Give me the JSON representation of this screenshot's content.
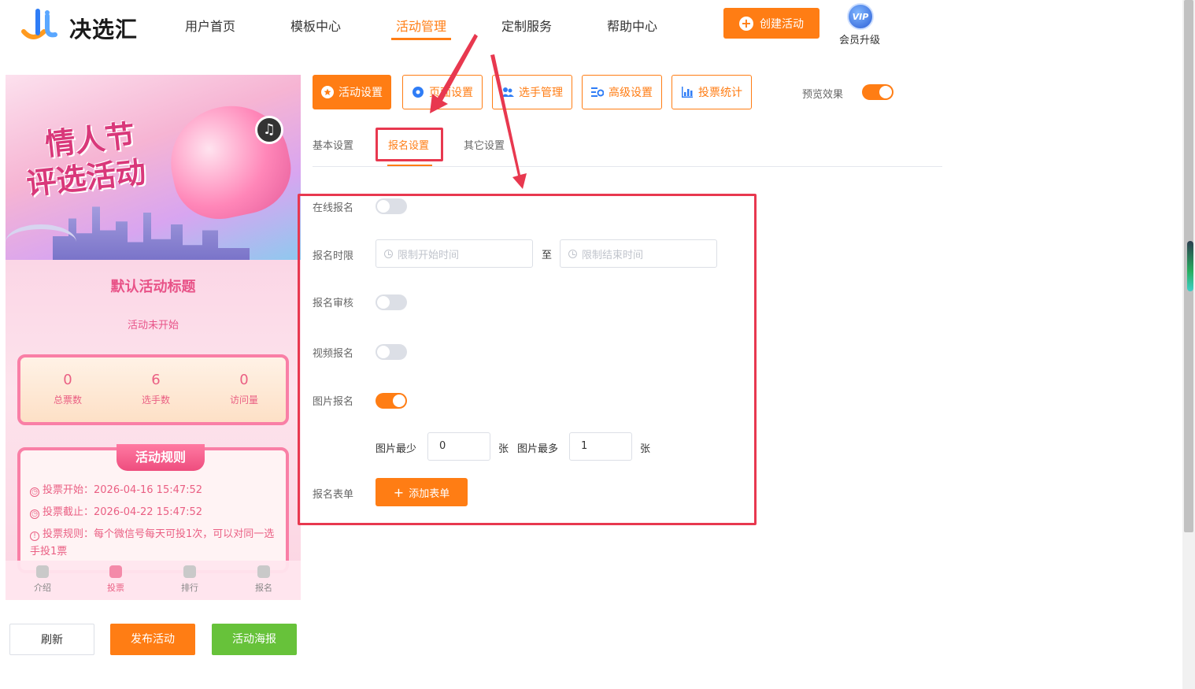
{
  "header": {
    "logo_text": "决选汇",
    "nav": [
      "用户首页",
      "模板中心",
      "活动管理",
      "定制服务",
      "帮助中心"
    ],
    "active_nav": "活动管理",
    "create_button": "创建活动",
    "vip_badge": "VIP",
    "vip_label": "会员升级"
  },
  "preview": {
    "banner_line1": "情人节",
    "banner_line2": "评选活动",
    "activity_title": "默认活动标题",
    "activity_status": "活动未开始",
    "stats": [
      {
        "value": "0",
        "label": "总票数"
      },
      {
        "value": "6",
        "label": "选手数"
      },
      {
        "value": "0",
        "label": "访问量"
      }
    ],
    "rules_title": "活动规则",
    "rules": [
      "投票开始：2026-04-16 15:47:52",
      "投票截止：2026-04-22 15:47:52",
      "投票规则：每个微信号每天可投1次，可以对同一选手投1票"
    ],
    "tabbar": [
      "介绍",
      "投票",
      "排行",
      "报名"
    ],
    "active_tab": "投票"
  },
  "actions": {
    "refresh": "刷新",
    "publish": "发布活动",
    "poster": "活动海报"
  },
  "toolbar": {
    "buttons": [
      "活动设置",
      "页面设置",
      "选手管理",
      "高级设置",
      "投票统计"
    ],
    "active": "活动设置",
    "preview_label": "预览效果",
    "preview_on": true
  },
  "subtabs": {
    "items": [
      "基本设置",
      "报名设置",
      "其它设置"
    ],
    "active": "报名设置"
  },
  "form": {
    "online_signup": {
      "label": "在线报名",
      "on": false
    },
    "time_limit": {
      "label": "报名时限",
      "start_placeholder": "限制开始时间",
      "separator": "至",
      "end_placeholder": "限制结束时间"
    },
    "review": {
      "label": "报名审核",
      "on": false
    },
    "video_signup": {
      "label": "视频报名",
      "on": false
    },
    "image_signup": {
      "label": "图片报名",
      "on": true
    },
    "image_min_label": "图片最少",
    "image_min_value": "0",
    "image_unit": "张",
    "image_max_label": "图片最多",
    "image_max_value": "1",
    "signup_form_label": "报名表单",
    "add_form_button": "添加表单"
  },
  "colors": {
    "accent": "#ff7d14",
    "annotation": "#e8384f",
    "green": "#67c23a"
  }
}
